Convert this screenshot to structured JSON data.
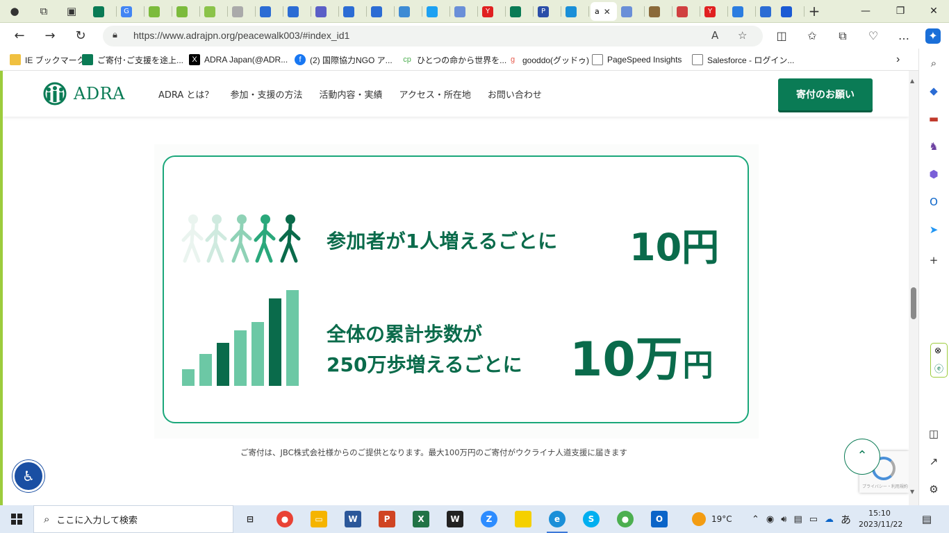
{
  "browser": {
    "active_tab_title": "a",
    "url": "https://www.adrajpn.org/peacewalk003/#index_id1",
    "bookmarks": [
      {
        "label": "IE ブックマーク",
        "color": "#f0c040"
      },
      {
        "label": "ご寄付･ご支援を途上...",
        "color": "#0a7b55"
      },
      {
        "label": "ADRA Japan(@ADR...",
        "color": "#000000"
      },
      {
        "label": "(2) 国際協力NGO ア...",
        "color": "#1877f2"
      },
      {
        "label": "ひとつの命から世界を...",
        "color": "#4caf50"
      },
      {
        "label": "gooddo(グッドゥ)",
        "color": "#e6584a"
      },
      {
        "label": "PageSpeed Insights",
        "color": "#777777"
      },
      {
        "label": "Salesforce - ログイン...",
        "color": "#777777"
      }
    ]
  },
  "site": {
    "logo_text": "ADRA",
    "nav": [
      "ADRA とは？",
      "参加・支援の方法",
      "活動内容・実績",
      "アクセス・所在地",
      "お問い合わせ"
    ],
    "donate_label": "寄付のお願い",
    "card": {
      "line1": "参加者が1人増えるごとに",
      "amount1": "10円",
      "line2a": "全体の累計歩数が",
      "line2b": "250万歩増えるごとに",
      "amount2_num": "10万",
      "amount2_unit": "円"
    },
    "note": "ご寄付は、JBC株式会社様からのご提供となります。最大100万円のご寄付がウクライナ人道支援に届きます",
    "scroll_top_icon": "chevron-up-icon",
    "brand_color": "#0a7b55"
  },
  "taskbar": {
    "search_placeholder": "ここに入力して検索",
    "weather": "19°C",
    "ime": "あ",
    "time": "15:10",
    "date": "2023/11/22"
  }
}
